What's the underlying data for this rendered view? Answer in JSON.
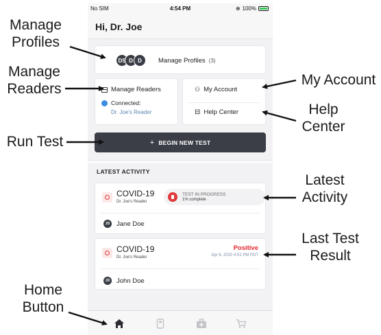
{
  "status_bar": {
    "carrier": "No SIM",
    "time": "4:54 PM",
    "battery": "100%"
  },
  "header": {
    "greeting": "Hi, Dr. Joe"
  },
  "profiles": {
    "avatars": [
      "DS",
      "D",
      "D"
    ],
    "label": "Manage Profiles",
    "count": "(3)"
  },
  "readers": {
    "label": "Manage Readers",
    "status": "Connected:",
    "reader_name": "Dr. Joe's Reader"
  },
  "account": {
    "my_account": "My Account",
    "help_center": "Help Center"
  },
  "begin_test": {
    "label": "BEGIN NEW TEST"
  },
  "latest_activity": {
    "title": "LATEST ACTIVITY",
    "items": [
      {
        "test": "COVID-19",
        "reader": "Dr. Joe's Reader",
        "status_title": "TEST IN PROGRESS",
        "status_detail": "1% complete",
        "person_initials": "JD",
        "person_name": "Jane Doe"
      },
      {
        "test": "COVID-19",
        "reader": "Dr. Joe's Reader",
        "result": "Positive",
        "result_date": "Apr 6, 2020 4:51 PM PDT",
        "person_initials": "JD",
        "person_name": "John Doe"
      }
    ]
  },
  "tabs": [
    {
      "icon": "home-icon",
      "active": true
    },
    {
      "icon": "reader-icon",
      "active": false
    },
    {
      "icon": "kit-icon",
      "active": false
    },
    {
      "icon": "cart-icon",
      "active": false
    }
  ],
  "annotations": {
    "manage_profiles": "Manage\nProfiles",
    "manage_readers": "Manage\nReaders",
    "run_test": "Run Test",
    "home_button": "Home\nButton",
    "my_account": "My Account",
    "help_center": "Help\nCenter",
    "latest_activity": "Latest\nActivity",
    "last_test_result": "Last Test\nResult"
  },
  "colors": {
    "accent_dark": "#3b3e46",
    "positive_red": "#e3262e",
    "connected_blue": "#3a8de0"
  }
}
